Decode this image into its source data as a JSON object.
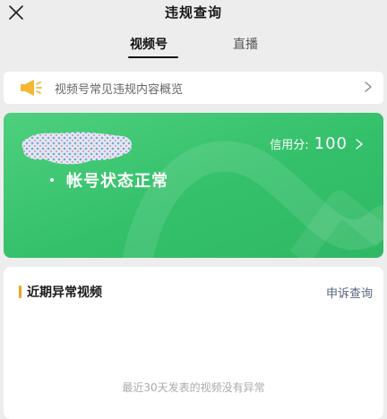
{
  "header": {
    "title": "违规查询"
  },
  "tabs": [
    {
      "label": "视频号",
      "active": true
    },
    {
      "label": "直播",
      "active": false
    }
  ],
  "notice": {
    "text": "视频号常见违规内容概览"
  },
  "account_card": {
    "credit_label": "信用分:",
    "credit_score": "100",
    "status": "帐号状态正常",
    "colors": {
      "start": "#4ed07e",
      "end": "#2fb864"
    }
  },
  "recent_videos": {
    "title": "近期异常视频",
    "appeal_link": "申诉查询",
    "empty_message": "最近30天发表的视频没有异常"
  },
  "icons": {
    "close": "close-icon",
    "notice": "speaker-icon",
    "chevron": "chevron-right-icon"
  },
  "colors": {
    "accent_orange": "#f0a020",
    "brand_green": "#34c06a",
    "link": "#57657c"
  }
}
